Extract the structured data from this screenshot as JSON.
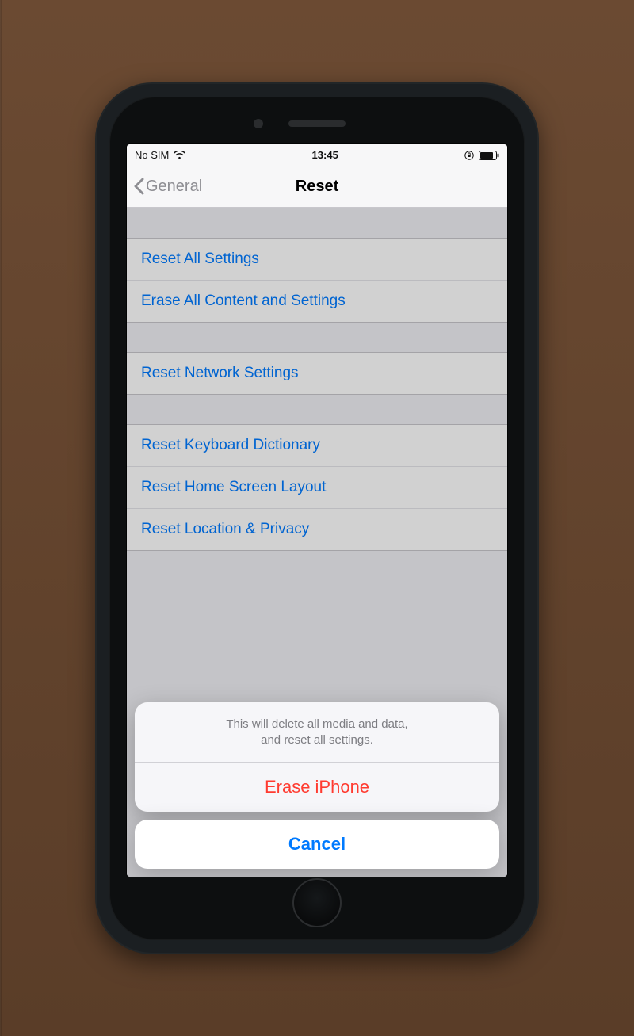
{
  "status": {
    "carrier": "No SIM",
    "time": "13:45"
  },
  "nav": {
    "back_label": "General",
    "title": "Reset"
  },
  "groups": [
    {
      "rows": [
        {
          "label": "Reset All Settings"
        },
        {
          "label": "Erase All Content and Settings"
        }
      ]
    },
    {
      "rows": [
        {
          "label": "Reset Network Settings"
        }
      ]
    },
    {
      "rows": [
        {
          "label": "Reset Keyboard Dictionary"
        },
        {
          "label": "Reset Home Screen Layout"
        },
        {
          "label": "Reset Location & Privacy"
        }
      ]
    }
  ],
  "sheet": {
    "message_line1": "This will delete all media and data,",
    "message_line2": "and reset all settings.",
    "destructive_label": "Erase iPhone",
    "cancel_label": "Cancel"
  },
  "colors": {
    "link": "#007aff",
    "destructive": "#ff3b30",
    "separator": "#c8c7cc",
    "background": "#efeff4"
  }
}
